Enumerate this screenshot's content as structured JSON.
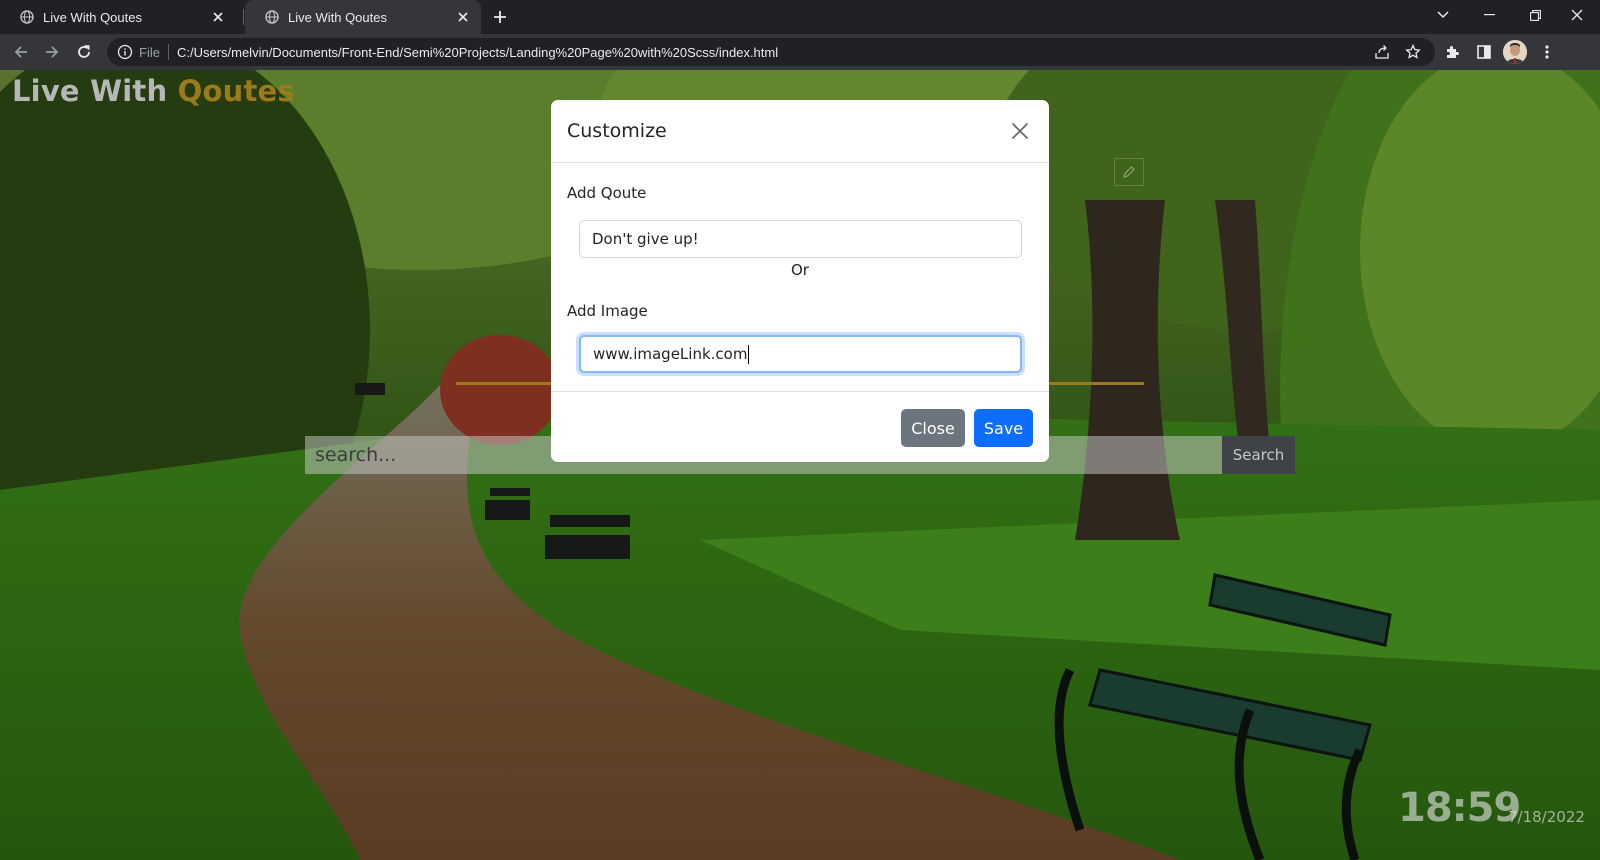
{
  "browser": {
    "tabs": [
      {
        "title": "Live With Qoutes",
        "active": false
      },
      {
        "title": "Live With Qoutes",
        "active": true
      }
    ],
    "omnibox": {
      "scheme_label": "File",
      "url": "C:/Users/melvin/Documents/Front-End/Semi%20Projects/Landing%20Page%20with%20Scss/index.html"
    },
    "icons": [
      "globe-icon",
      "close-icon",
      "plus-icon",
      "chevron-down-icon",
      "minimize-icon",
      "restore-icon",
      "back-icon",
      "forward-icon",
      "reload-icon",
      "info-icon",
      "share-icon",
      "star-icon",
      "extensions-icon",
      "side-panel-icon",
      "avatar",
      "kebab-menu-icon"
    ]
  },
  "page": {
    "brand": {
      "part1": "Live With ",
      "part2": "Qoutes"
    },
    "search": {
      "placeholder": "search...",
      "button_label": "Search"
    },
    "clock": {
      "time": "18:59",
      "date": "7/18/2022"
    },
    "colors": {
      "accent": "#9b7a1c",
      "primary": "#0d6efd",
      "secondary": "#6c757d"
    }
  },
  "modal": {
    "title": "Customize",
    "quote_label": "Add Qoute",
    "quote_value": "Don't give up!",
    "or_text": "Or",
    "image_label": "Add Image",
    "image_value": "www.imageLink.com",
    "close_label": "Close",
    "save_label": "Save"
  }
}
